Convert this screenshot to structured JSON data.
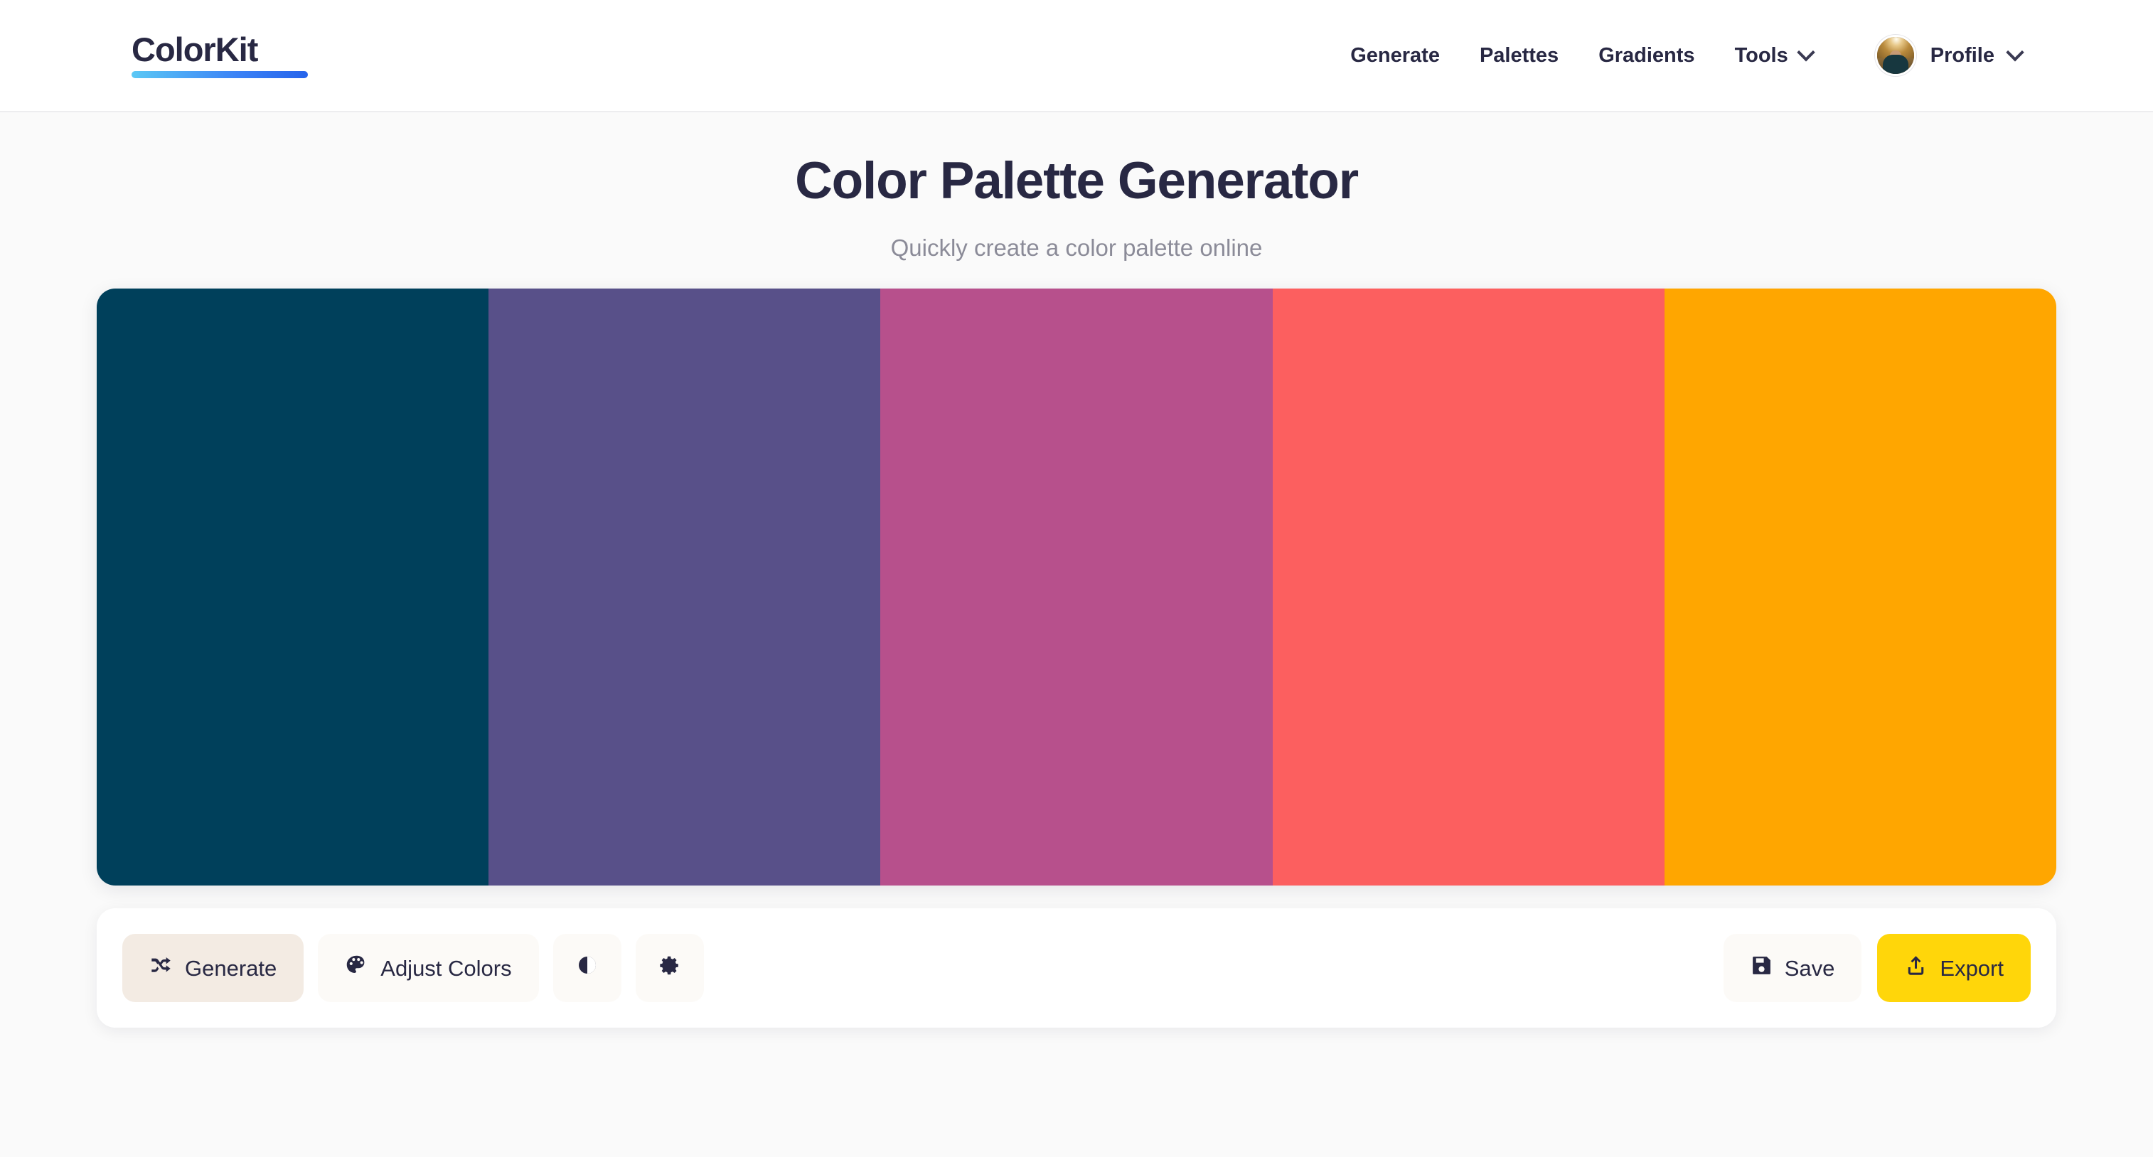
{
  "brand": {
    "name": "ColorKit",
    "underline_gradient_from": "#5BC8F5",
    "underline_gradient_to": "#2563EB"
  },
  "nav": {
    "items": [
      {
        "label": "Generate",
        "icon": "",
        "has_chevron": false
      },
      {
        "label": "Palettes",
        "icon": "",
        "has_chevron": false
      },
      {
        "label": "Gradients",
        "icon": "",
        "has_chevron": false
      },
      {
        "label": "Tools",
        "icon": "chevron-down-icon",
        "has_chevron": true
      }
    ],
    "profile": {
      "label": "Profile",
      "avatar_icon": "avatar-image",
      "chevron_icon": "chevron-down-icon"
    }
  },
  "hero": {
    "title": "Color Palette Generator",
    "subtitle": "Quickly create a color palette online"
  },
  "palette": {
    "colors": [
      {
        "hex": "#00405B",
        "name": "swatch-1"
      },
      {
        "hex": "#585089",
        "name": "swatch-2"
      },
      {
        "hex": "#B7508C",
        "name": "swatch-3"
      },
      {
        "hex": "#FC5F5F",
        "name": "swatch-4"
      },
      {
        "hex": "#FFA600",
        "name": "swatch-5"
      }
    ]
  },
  "toolbar": {
    "generate_label": "Generate",
    "generate_icon": "shuffle-icon",
    "adjust_label": "Adjust Colors",
    "adjust_icon": "palette-icon",
    "contrast_icon": "contrast-icon",
    "settings_icon": "gear-icon",
    "save_label": "Save",
    "save_icon": "floppy-disk-icon",
    "export_label": "Export",
    "export_icon": "upload-icon",
    "export_bg": "#FFD60A",
    "generate_bg": "#F3EBE3"
  }
}
